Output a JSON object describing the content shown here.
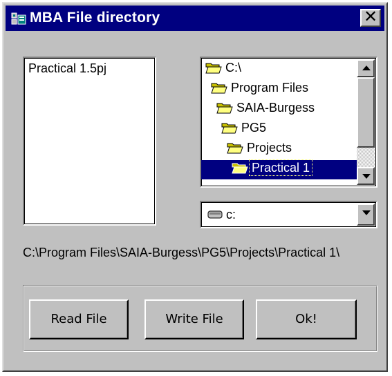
{
  "window": {
    "title": "MBA File directory",
    "close_label": "✕",
    "colors": {
      "titlebar": "#000080",
      "face": "#c0c0c0",
      "selection": "#000080"
    }
  },
  "file_list": {
    "items": [
      "Practical 1.5pj"
    ]
  },
  "directory_tree": {
    "items": [
      {
        "label": "C:\\",
        "icon": "open-folder-icon",
        "selected": false
      },
      {
        "label": "Program Files",
        "icon": "open-folder-icon",
        "selected": false
      },
      {
        "label": "SAIA-Burgess",
        "icon": "open-folder-icon",
        "selected": false
      },
      {
        "label": "PG5",
        "icon": "open-folder-icon",
        "selected": false
      },
      {
        "label": "Projects",
        "icon": "open-folder-icon",
        "selected": false
      },
      {
        "label": "Practical 1",
        "icon": "open-folder-icon",
        "selected": true
      }
    ]
  },
  "drive_select": {
    "value": "c:",
    "icon": "drive-icon"
  },
  "current_path": "C:\\Program Files\\SAIA-Burgess\\PG5\\Projects\\Practical 1\\",
  "buttons": {
    "read": "Read File",
    "write": "Write File",
    "ok": "Ok!"
  }
}
